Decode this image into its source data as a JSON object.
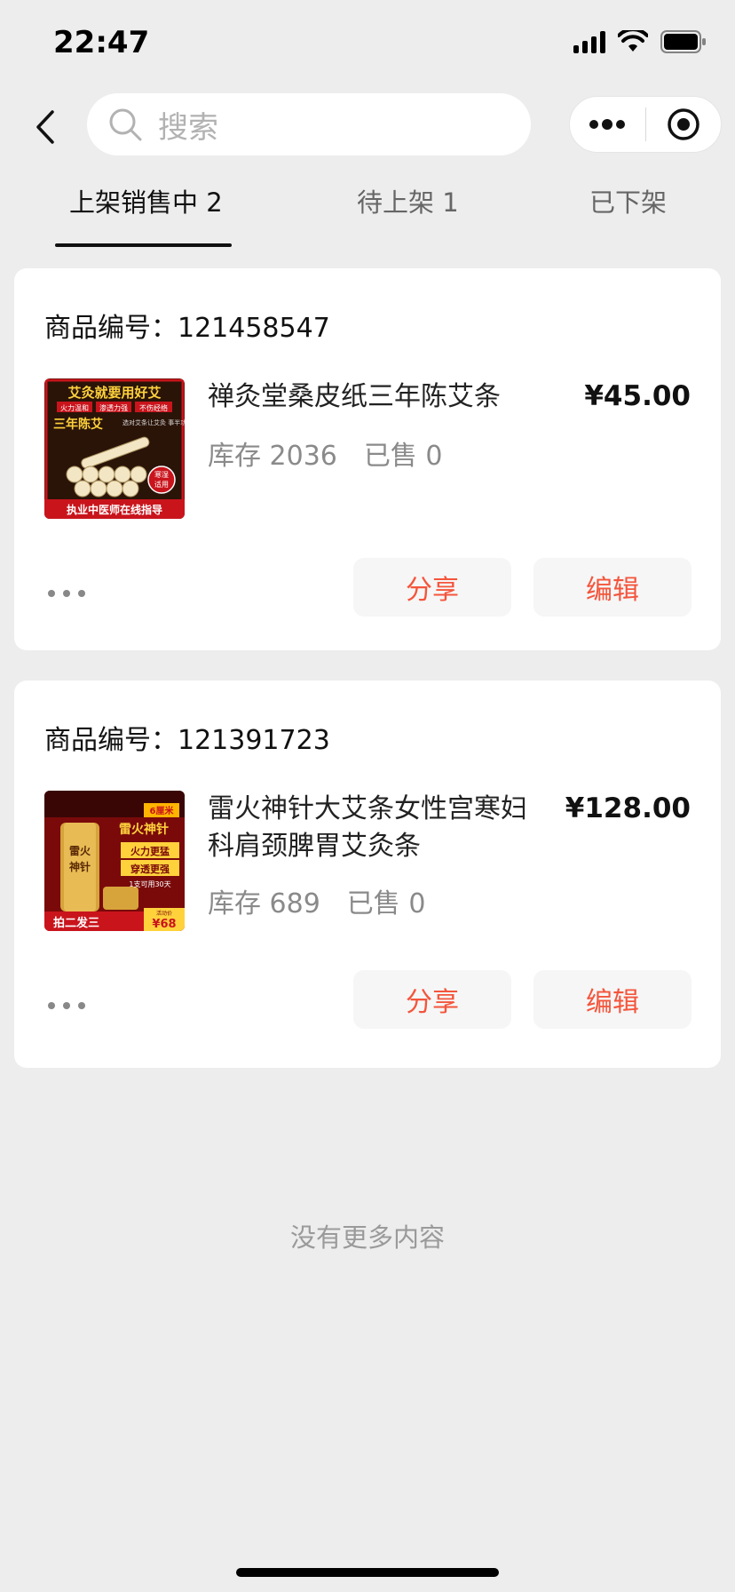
{
  "status_bar": {
    "time": "22:47"
  },
  "search": {
    "placeholder": "搜索"
  },
  "tabs": [
    {
      "label": "上架销售中 2",
      "active": true
    },
    {
      "label": "待上架 1",
      "active": false
    },
    {
      "label": "已下架",
      "active": false
    }
  ],
  "products": [
    {
      "id_label": "商品编号：121458547",
      "title": "禅灸堂桑皮纸三年陈艾条",
      "price": "¥45.00",
      "stock": "库存 2036",
      "sold": "已售 0",
      "thumb": {
        "headline": "艾灸就要用好艾",
        "tags": [
          "火力温和",
          "渗透力强",
          "不伤经络"
        ],
        "sub": "三年陈艾",
        "note": "选对艾条让艾灸 事半功倍",
        "badge": "寒湿 适用",
        "footer": "执业中医师在线指导"
      },
      "share_label": "分享",
      "edit_label": "编辑"
    },
    {
      "id_label": "商品编号：121391723",
      "title": "雷火神针大艾条女性宫寒妇科肩颈脾胃艾灸条",
      "price": "¥128.00",
      "stock": "库存 689",
      "sold": "已售 0",
      "thumb": {
        "size_tag": "6厘米",
        "brand": "雷火神针",
        "slogan1": "火力更猛",
        "slogan2": "穿透更强",
        "note": "1支可用30天",
        "footer": "拍二发三",
        "price_tag": "¥68",
        "price_caption": "活动价"
      },
      "share_label": "分享",
      "edit_label": "编辑"
    }
  ],
  "footer": {
    "no_more": "没有更多内容"
  },
  "colors": {
    "accent": "#f4553c",
    "background": "#ededed"
  }
}
